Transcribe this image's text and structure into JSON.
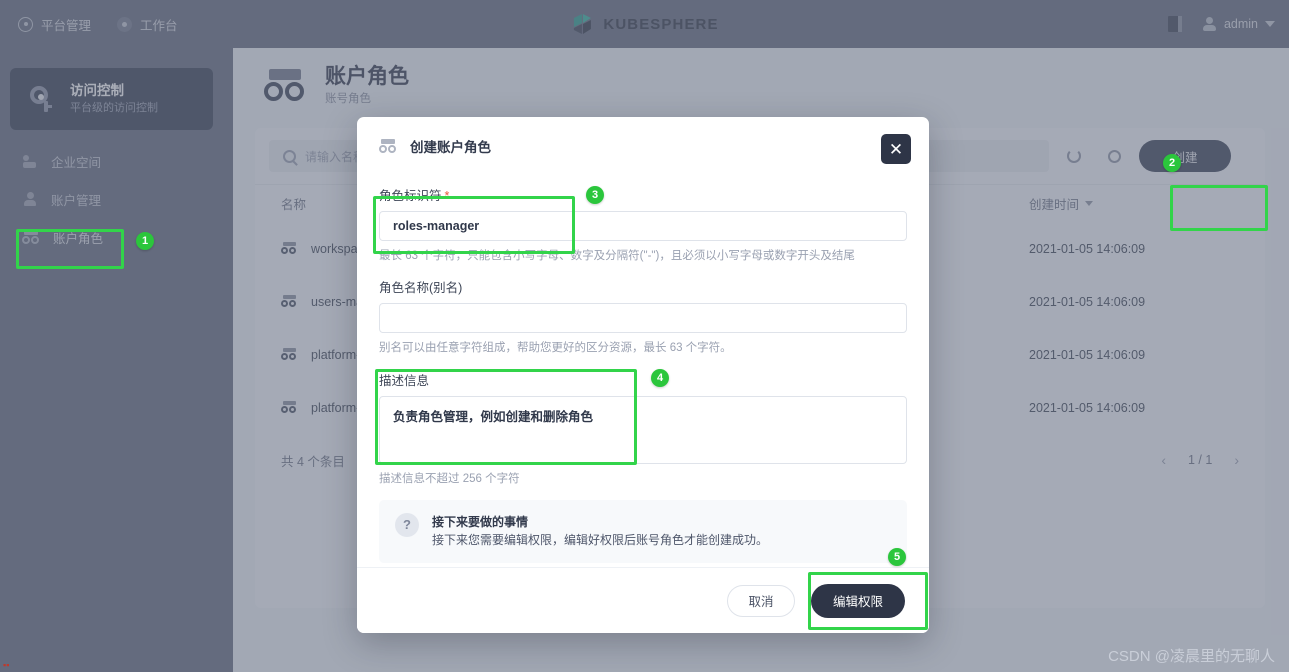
{
  "topbar": {
    "nav": [
      {
        "label": "平台管理",
        "icon": "platform-icon"
      },
      {
        "label": "工作台",
        "icon": "workbench-icon"
      }
    ],
    "brand": "KUBESPHERE",
    "user": "admin",
    "docs_icon": "book-icon",
    "caret_icon": "chevron-down-icon"
  },
  "sidebar": {
    "card_title": "访问控制",
    "card_sub": "平台级的访问控制",
    "items": [
      {
        "label": "企业空间",
        "icon": "workspace-icon"
      },
      {
        "label": "账户管理",
        "icon": "user-icon"
      },
      {
        "label": "账户角色",
        "icon": "roles-icon"
      }
    ]
  },
  "page": {
    "title": "账户角色",
    "subtitle": "账号角色",
    "icon": "roles-icon"
  },
  "toolbar": {
    "search_placeholder": "请输入名称搜索",
    "search_icon": "search-icon",
    "refresh_icon": "refresh-icon",
    "gear_icon": "gear-icon",
    "create_label": "创建"
  },
  "table": {
    "columns": {
      "name": "名称",
      "time": "创建时间"
    },
    "rows": [
      {
        "name": "workspaces-manager",
        "time": "2021-01-05 14:06:09"
      },
      {
        "name": "users-manager",
        "time": "2021-01-05 14:06:09"
      },
      {
        "name": "platform-regular",
        "time": "2021-01-05 14:06:09"
      },
      {
        "name": "platform-admin",
        "time": "2021-01-05 14:06:09"
      }
    ],
    "total": "共 4 个条目",
    "page": "1 / 1",
    "prev_icon": "chevron-left-icon",
    "next_icon": "chevron-right-icon"
  },
  "modal": {
    "title": "创建账户角色",
    "title_icon": "roles-icon",
    "close_icon": "close-icon",
    "fields": {
      "identifier": {
        "label": "角色标识符",
        "required": "*",
        "value": "roles-manager",
        "hint": "最长 63 个字符，只能包含小写字母、数字及分隔符(\"-\")，且必须以小写字母或数字开头及结尾"
      },
      "alias": {
        "label": "角色名称(别名)",
        "value": "",
        "placeholder": "",
        "hint": "别名可以由任意字符组成，帮助您更好的区分资源，最长 63 个字符。"
      },
      "description": {
        "label": "描述信息",
        "value": "负责角色管理，例如创建和删除角色",
        "hint": "描述信息不超过 256 个字符"
      }
    },
    "tip": {
      "icon": "question-icon",
      "title": "接下来要做的事情",
      "desc": "接下来您需要编辑权限，编辑好权限后账号角色才能创建成功。"
    },
    "buttons": {
      "cancel": "取消",
      "primary": "编辑权限"
    }
  },
  "annotations": {
    "badges": [
      {
        "n": "1"
      },
      {
        "n": "2"
      },
      {
        "n": "3"
      },
      {
        "n": "4"
      },
      {
        "n": "5"
      }
    ],
    "highlight_color": "#32d44a",
    "badge_color": "#2bc63c"
  },
  "watermark": "CSDN @凌晨里的无聊人"
}
